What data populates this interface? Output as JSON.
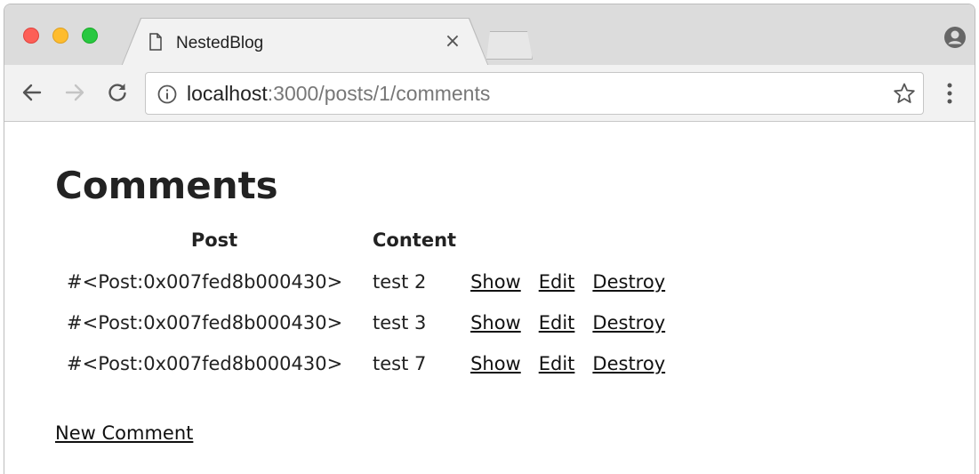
{
  "browser": {
    "tab_title": "NestedBlog",
    "close_symbol": "×",
    "url_host": "localhost",
    "url_rest": ":3000/posts/1/comments",
    "icons": {
      "favicon": "document-icon",
      "profile": "account-icon",
      "back": "back-arrow-icon",
      "forward": "forward-arrow-icon",
      "reload": "reload-icon",
      "info": "info-icon",
      "bookmark": "star-icon",
      "menu": "kebab-menu-icon"
    }
  },
  "page": {
    "title": "Comments",
    "table": {
      "headers": {
        "post": "Post",
        "content": "Content"
      },
      "rows": [
        {
          "post": "#<Post:0x007fed8b000430>",
          "content": "test 2",
          "show": "Show",
          "edit": "Edit",
          "destroy": "Destroy"
        },
        {
          "post": "#<Post:0x007fed8b000430>",
          "content": "test 3",
          "show": "Show",
          "edit": "Edit",
          "destroy": "Destroy"
        },
        {
          "post": "#<Post:0x007fed8b000430>",
          "content": "test 7",
          "show": "Show",
          "edit": "Edit",
          "destroy": "Destroy"
        }
      ]
    },
    "new_comment_link": "New Comment"
  }
}
